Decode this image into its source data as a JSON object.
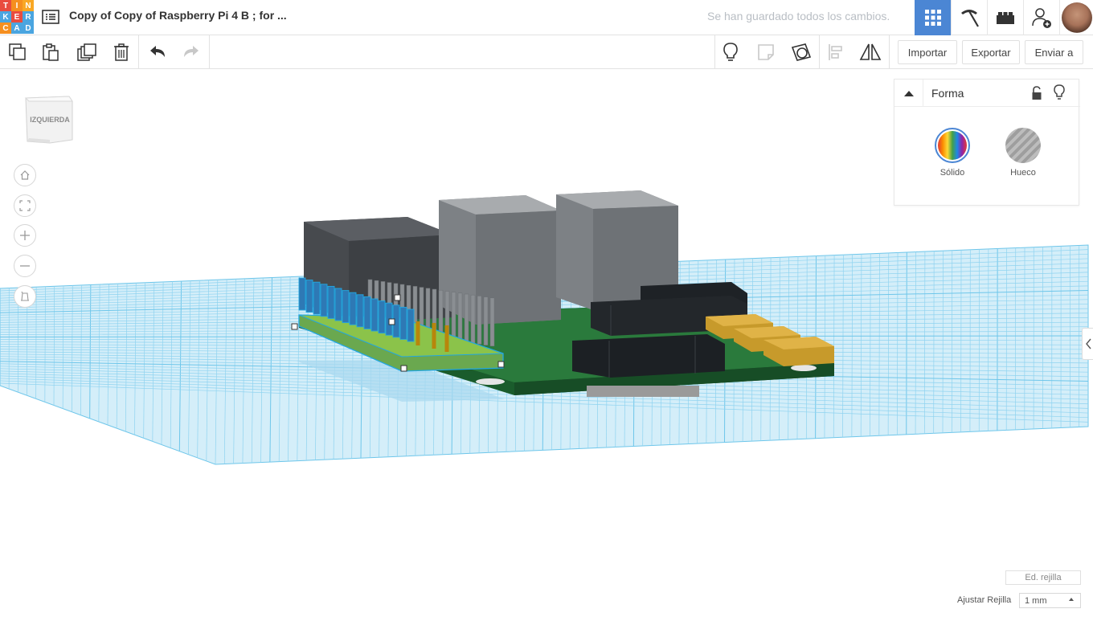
{
  "header": {
    "logo_letters": [
      "T",
      "I",
      "N",
      "K",
      "E",
      "R",
      "C",
      "A",
      "D"
    ],
    "logo_colors": [
      "#e94c3f",
      "#f58f1f",
      "#f9a825",
      "#4aa5e0",
      "#e94c3f",
      "#4aa5e0",
      "#f58f1f",
      "#4aa5e0",
      "#4aa5e0"
    ],
    "title": "Copy of Copy of Raspberry Pi 4 B ; for ...",
    "save_status": "Se han guardado todos los cambios.",
    "icons": [
      "grid-view-icon",
      "pickaxe-icon",
      "bricks-icon",
      "add-user-icon"
    ],
    "active_color": "#4b86d4"
  },
  "toolbar": {
    "left_icons": [
      "copy-icon",
      "paste-icon",
      "duplicate-icon",
      "trash-icon",
      "undo-icon",
      "redo-icon"
    ],
    "right_icons": [
      "bulb-icon",
      "note-icon",
      "workplane-icon",
      "align-icon",
      "mirror-icon"
    ],
    "import_label": "Importar",
    "export_label": "Exportar",
    "send_label": "Enviar a"
  },
  "viewcube": {
    "face_label": "IZQUIERDA"
  },
  "nav_controls": [
    "home-icon",
    "fit-icon",
    "zoom-in-icon",
    "zoom-out-icon",
    "perspective-icon"
  ],
  "shape_panel": {
    "title": "Forma",
    "solid_label": "Sólido",
    "hole_label": "Hueco"
  },
  "grid": {
    "edit_label": "Ed. rejilla",
    "snap_label": "Ajustar Rejilla",
    "snap_value": "1 mm"
  },
  "colors": {
    "grid_line": "#6ec6ea",
    "grid_fill": "#d4eef9",
    "board_green": "#1f6a33",
    "selection": "#22a7e0"
  }
}
